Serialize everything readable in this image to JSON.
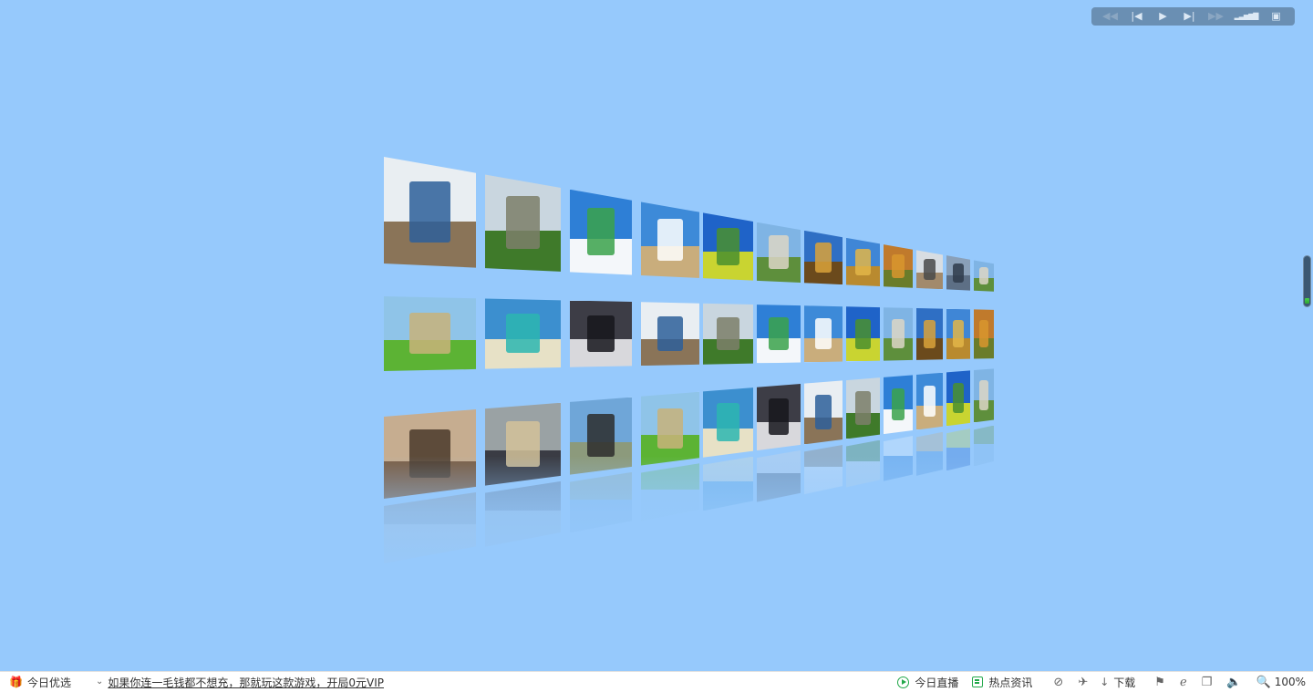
{
  "player": {
    "buttons": [
      {
        "name": "rewind-icon",
        "glyph": "◀◀",
        "dim": true
      },
      {
        "name": "previous-icon",
        "glyph": "|◀",
        "dim": false
      },
      {
        "name": "play-icon",
        "glyph": "▶",
        "dim": false
      },
      {
        "name": "next-icon",
        "glyph": "▶|",
        "dim": false
      },
      {
        "name": "fast-forward-icon",
        "glyph": "▶▶",
        "dim": true
      },
      {
        "name": "volume-bars-icon",
        "glyph": "▂▃▅▆▇",
        "dim": false
      },
      {
        "name": "fullscreen-icon",
        "glyph": "▣",
        "dim": false
      }
    ]
  },
  "gallery": {
    "rows": [
      {
        "tiles": [
          "building",
          "castle",
          "beach",
          "fountain",
          "field",
          "palace",
          "temple",
          "pagoda",
          "autumn",
          "statue",
          "city",
          "palace"
        ]
      },
      {
        "tiles": [
          "meadow",
          "lagoon",
          "portrait",
          "building",
          "castle",
          "beach",
          "fountain",
          "field",
          "palace",
          "temple",
          "pagoda",
          "autumn"
        ]
      },
      {
        "tiles": [
          "dragon",
          "ferris",
          "group",
          "meadow",
          "lagoon",
          "portrait",
          "building",
          "castle",
          "beach",
          "fountain",
          "field",
          "palace"
        ]
      }
    ],
    "palettes": {
      "building": {
        "sky": "#e9eef2",
        "ground": "#8a7458",
        "obj": "#2d5f9a"
      },
      "castle": {
        "sky": "#c9d6df",
        "ground": "#3f7a2a",
        "obj": "#7c7f6a"
      },
      "beach": {
        "sky": "#2e7fd6",
        "ground": "#f4f7fa",
        "obj": "#3aa24a"
      },
      "fountain": {
        "sky": "#3d8ad8",
        "ground": "#c9ad7c",
        "obj": "#ffffff"
      },
      "field": {
        "sky": "#1f63c8",
        "ground": "#c9d431",
        "obj": "#4a8f2e"
      },
      "palace": {
        "sky": "#7fb4e4",
        "ground": "#5e8f3c",
        "obj": "#dcd6c6"
      },
      "temple": {
        "sky": "#2f6fc4",
        "ground": "#6b4a1c",
        "obj": "#d9a23a"
      },
      "pagoda": {
        "sky": "#3f86d6",
        "ground": "#b98a2f",
        "obj": "#e2b548"
      },
      "autumn": {
        "sky": "#c07a2c",
        "ground": "#6a7c2a",
        "obj": "#d8962e"
      },
      "statue": {
        "sky": "#d8dde2",
        "ground": "#a28a6c",
        "obj": "#4a4a4a"
      },
      "city": {
        "sky": "#8aa0b8",
        "ground": "#5d6f85",
        "obj": "#2e3b4a"
      },
      "meadow": {
        "sky": "#8fc4e8",
        "ground": "#5cb334",
        "obj": "#c8b37a"
      },
      "lagoon": {
        "sky": "#3c8fcf",
        "ground": "#e7e1c6",
        "obj": "#2bb6b0"
      },
      "portrait": {
        "sky": "#3d3d46",
        "ground": "#d8d8dc",
        "obj": "#16161c"
      },
      "dragon": {
        "sky": "#c6ad90",
        "ground": "#7a5d44",
        "obj": "#4a3a2c"
      },
      "ferris": {
        "sky": "#9aa2a4",
        "ground": "#3a3c44",
        "obj": "#d3c29a"
      },
      "group": {
        "sky": "#6fa6d8",
        "ground": "#8c9a7c",
        "obj": "#2d2d2d"
      }
    }
  },
  "statusbar": {
    "left": [
      {
        "label": "今日优选"
      },
      {
        "label": "如果你连一毛钱都不想充，那就玩这款游戏，开局0元VIP"
      }
    ],
    "right": {
      "live": "今日直播",
      "news": "热点资讯",
      "download": "下载",
      "zoom": "100%"
    }
  }
}
